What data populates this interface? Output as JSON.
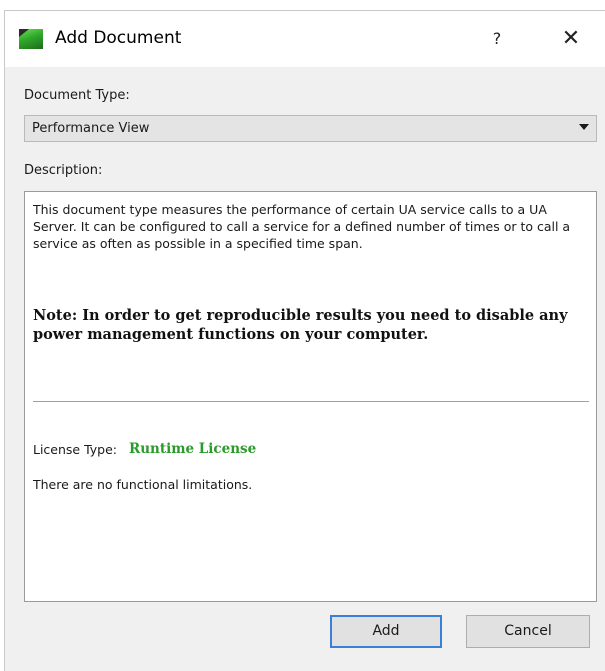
{
  "window": {
    "title": "Add Document",
    "help_label": "?",
    "close_label": "✕",
    "icon": "app-document-icon"
  },
  "form": {
    "document_type_label": "Document Type:",
    "document_type_value": "Performance View",
    "description_label": "Description:"
  },
  "description": {
    "text": "This document type measures the performance of certain UA service calls to a UA Server. It can be configured to call a service for a defined number of times or to call a service as often as possible in a specified time span.",
    "note": "Note: In order to get reproducible results you need to disable any power management functions on your computer.",
    "license_label": "License Type:",
    "license_value": "Runtime License",
    "limitations": "There are no functional limitations."
  },
  "buttons": {
    "add": "Add",
    "cancel": "Cancel"
  },
  "colors": {
    "license_green": "#2a9a2a",
    "dialog_bg": "#f0f0f0",
    "focus_border": "#3c7fd6"
  }
}
